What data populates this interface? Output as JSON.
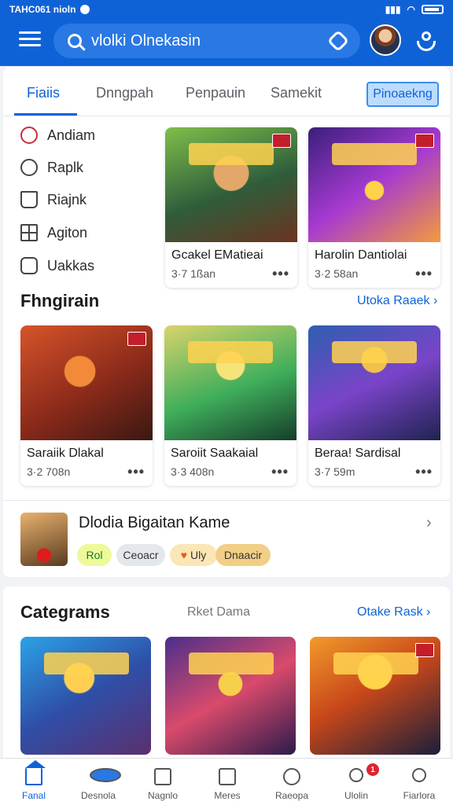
{
  "status_bar": {
    "left_text": "TAHC061 nioln",
    "icon": "status-icons"
  },
  "header": {
    "search_placeholder": "vlolki Olnekasin",
    "menu_icon": "hamburger-icon",
    "settings_icon": "settings-icon",
    "profile_icon": "profile-icon"
  },
  "tabs": [
    {
      "label": "Fiaiis",
      "active": true
    },
    {
      "label": "Dnngpah",
      "active": false
    },
    {
      "label": "Penpauin",
      "active": false
    },
    {
      "label": "Samekit",
      "active": false
    }
  ],
  "tab_pill": "Pinoaekng",
  "sidebar": [
    {
      "label": "Andiam",
      "icon": "clock-icon"
    },
    {
      "label": "Raplk",
      "icon": "check-circle-icon"
    },
    {
      "label": "Riajnk",
      "icon": "cup-icon"
    },
    {
      "label": "Agiton",
      "icon": "grid-icon"
    },
    {
      "label": "Uakkas",
      "icon": "tag-icon"
    }
  ],
  "top_games": [
    {
      "title": "Gcakel EMatieai",
      "meta": "3·7 1ßan"
    },
    {
      "title": "Harolin Dantiolai",
      "meta": "3·2 58an"
    }
  ],
  "section_1": {
    "title": "Fhngirain",
    "see_all": "Utoka Raaek ›"
  },
  "games": [
    {
      "title": "Saraiik Dlakal",
      "meta": "3·2 708n"
    },
    {
      "title": "Saroiit Saakaial",
      "meta": "3·3 408n"
    },
    {
      "title": "Beraa! Sardisal",
      "meta": "3·7 59m"
    }
  ],
  "feature": {
    "title": "Dlodia Bigaitan Kame",
    "chips": [
      "Rol",
      "Ceoacr",
      "Uly",
      "Dnaacir"
    ]
  },
  "categories": {
    "title": "Categrams",
    "subtitle": "Rket Dama",
    "see_all": "Otake Rask ›"
  },
  "bottom_nav": [
    {
      "label": "Fanal",
      "active": true
    },
    {
      "label": "Desnola",
      "active": false
    },
    {
      "label": "Nagnlo",
      "active": false
    },
    {
      "label": "Meres",
      "active": false
    },
    {
      "label": "Raeopa",
      "active": false
    },
    {
      "label": "Ulolin",
      "active": false,
      "badge": "1"
    },
    {
      "label": "Fiarlora",
      "active": false
    }
  ],
  "colors": {
    "primary": "#0f62d6",
    "badge": "#e0232e"
  }
}
